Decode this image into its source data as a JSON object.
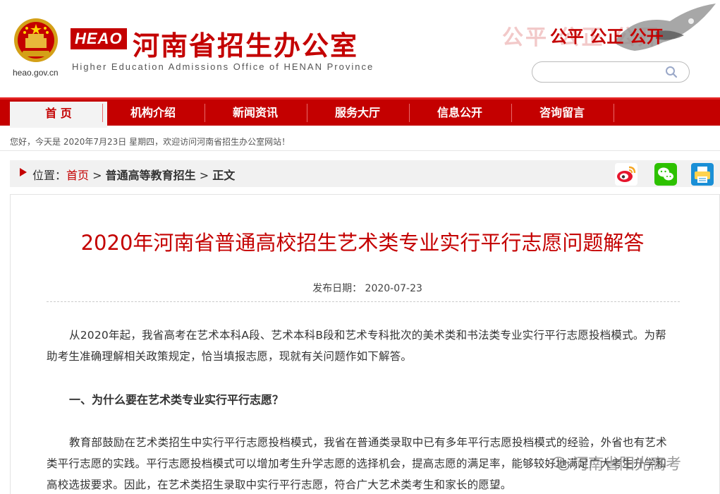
{
  "header": {
    "site_url": "heao.gov.cn",
    "logo_text": "HEAO",
    "title": "河南省招生办公室",
    "subtitle": "Higher Education Admissions Office of HENAN Province",
    "slogan_ghost": "公平 公正 公开",
    "slogan": "公平 公正 公开",
    "search_placeholder": ""
  },
  "nav": {
    "items": [
      {
        "label": "首 页"
      },
      {
        "label": "机构介绍"
      },
      {
        "label": "新闻资讯"
      },
      {
        "label": "服务大厅"
      },
      {
        "label": "信息公开"
      },
      {
        "label": "咨询留言"
      }
    ]
  },
  "welcome": "您好，今天是 2020年7月23日 星期四，欢迎访问河南省招生办公室网站！",
  "breadcrumb": {
    "prefix": "位置：",
    "home": "首页",
    "sep1": " > ",
    "section": "普通高等教育招生",
    "sep2": " > ",
    "current": "正文"
  },
  "share": {
    "icons": [
      "weibo-icon",
      "wechat-icon",
      "print-icon"
    ]
  },
  "article": {
    "title": "2020年河南省普通高校招生艺术类专业实行平行志愿问题解答",
    "date_label": "发布日期：",
    "date": "2020-07-23",
    "para1": "从2020年起，我省高考在艺术本科A段、艺术本科B段和艺术专科批次的美术类和书法类专业实行平行志愿投档模式。为帮助考生准确理解相关政策规定，恰当填报志愿，现就有关问题作如下解答。",
    "q1": "一、为什么要在艺术类专业实行平行志愿？",
    "para2": "教育部鼓励在艺术类招生中实行平行志愿投档模式，我省在普通类录取中已有多年平行志愿投档模式的经验，外省也有艺术类平行志愿的实践。平行志愿投档模式可以增加考生升学志愿的选择机会，提高志愿的满足率，能够较好地满足广大考生升学和高校选拔要求。因此，在艺术类招生录取中实行平行志愿，符合广大艺术类考生和家长的愿望。"
  },
  "watermark": "河南省阳光高考",
  "colors": {
    "brand_red": "#c40000",
    "nav_bg": "#c40000",
    "crumb_bg": "#f1f1f1"
  }
}
